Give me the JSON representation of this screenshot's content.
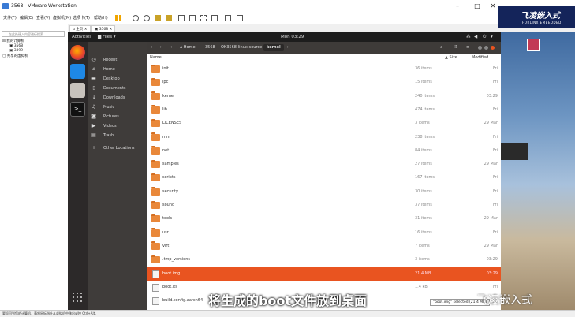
{
  "vmware": {
    "title": "3568 - VMware Workstation",
    "menu": [
      "文件(F)",
      "编辑(E)",
      "查看(V)",
      "虚拟机(M)",
      "选项卡(T)",
      "帮助(H)"
    ],
    "library_search_placeholder": "在此处键入内容进行搜索",
    "library": {
      "root": "我的计算机",
      "items": [
        "3568",
        "3399"
      ],
      "shared": "共享的虚拟机"
    },
    "tabs": [
      "主页",
      "3568"
    ],
    "status": "要返回到您的计算机，请将鼠标指针从虚拟机中移出或按 Ctrl+Alt。"
  },
  "ubuntu": {
    "activities": "Activities",
    "files_menu": "Files",
    "clock": "Mon 03:29",
    "breadcrumb": [
      "Home",
      "3568",
      "OK3568-linux-source",
      "kernel"
    ],
    "sidebar": [
      "Recent",
      "Home",
      "Desktop",
      "Documents",
      "Downloads",
      "Music",
      "Pictures",
      "Videos",
      "Trash",
      "Other Locations"
    ],
    "columns": {
      "name": "Name",
      "size": "Size",
      "modified": "Modified"
    },
    "rows": [
      {
        "name": "init",
        "size": "36 items",
        "modified": "Fri"
      },
      {
        "name": "ipc",
        "size": "15 items",
        "modified": "Fri"
      },
      {
        "name": "kernel",
        "size": "240 items",
        "modified": "03:29"
      },
      {
        "name": "lib",
        "size": "474 items",
        "modified": "Fri"
      },
      {
        "name": "LICENSES",
        "size": "3 items",
        "modified": "29 Mar"
      },
      {
        "name": "mm",
        "size": "238 items",
        "modified": "Fri"
      },
      {
        "name": "net",
        "size": "84 items",
        "modified": "Fri"
      },
      {
        "name": "samples",
        "size": "27 items",
        "modified": "29 Mar"
      },
      {
        "name": "scripts",
        "size": "167 items",
        "modified": "Fri"
      },
      {
        "name": "security",
        "size": "30 items",
        "modified": "Fri"
      },
      {
        "name": "sound",
        "size": "37 items",
        "modified": "Fri"
      },
      {
        "name": "tools",
        "size": "31 items",
        "modified": "29 Mar"
      },
      {
        "name": "usr",
        "size": "16 items",
        "modified": "Fri"
      },
      {
        "name": "virt",
        "size": "7 items",
        "modified": "29 Mar"
      },
      {
        "name": ".tmp_versions",
        "size": "3 items",
        "modified": "03:29"
      },
      {
        "name": "boot.img",
        "size": "21.4 MB",
        "modified": "03:29"
      },
      {
        "name": "boot.its",
        "size": "1.4 kB",
        "modified": "Fri"
      },
      {
        "name": "build.config.aarch64",
        "size": "",
        "modified": ""
      }
    ],
    "selected_row": 15,
    "tooltip": "\"boot.img\" selected (21.4 MB)"
  },
  "overlay": {
    "caption": "将生成的boot文件放到桌面",
    "watermark": "飞凌嵌入式",
    "logo_main": "飞凌嵌入式",
    "logo_sub": "FORLINX EMBEDDED"
  },
  "colors": {
    "accent": "#e95420",
    "folder": "#e9883a",
    "logo_bg": "#14245a"
  }
}
